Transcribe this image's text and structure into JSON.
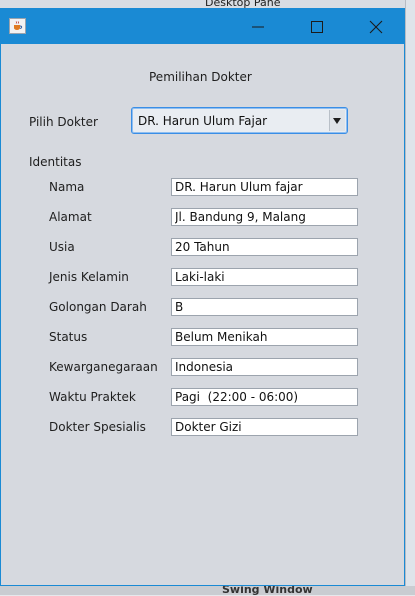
{
  "background": {
    "desktop_pane_label": "Desktop Pane",
    "swing_window_label": "Swing Window"
  },
  "window": {
    "title": "",
    "title_bar_color": "#1a8ad4",
    "icons": {
      "app": "java-cup-icon",
      "minimize": "minimize-icon",
      "maximize": "maximize-icon",
      "close": "close-icon"
    }
  },
  "form": {
    "heading": "Pemilihan Dokter",
    "pilih_label": "Pilih Dokter",
    "selected_doctor": "DR. Harun Ulum Fajar",
    "identitas_label": "Identitas",
    "fields": [
      {
        "label": "Nama",
        "value": "DR. Harun Ulum fajar"
      },
      {
        "label": "Alamat",
        "value": "Jl. Bandung 9, Malang"
      },
      {
        "label": "Usia",
        "value": "20 Tahun"
      },
      {
        "label": "Jenis Kelamin",
        "value": "Laki-laki"
      },
      {
        "label": "Golongan Darah",
        "value": "B"
      },
      {
        "label": "Status",
        "value": "Belum Menikah"
      },
      {
        "label": "Kewarganegaraan",
        "value": "Indonesia"
      },
      {
        "label": "Waktu Praktek",
        "value": "Pagi  (22:00 - 06:00)"
      },
      {
        "label": "Dokter Spesialis",
        "value": "Dokter Gizi"
      }
    ]
  }
}
